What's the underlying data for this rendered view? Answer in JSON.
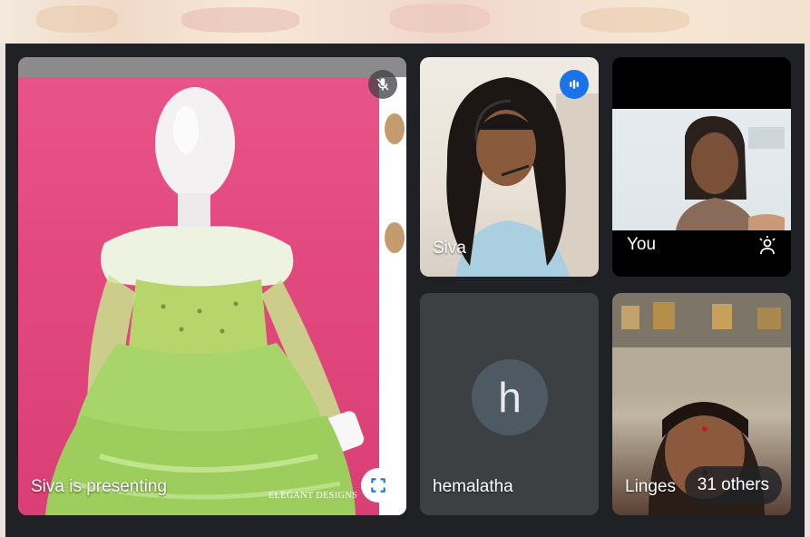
{
  "presentation": {
    "label": "Siva is presenting",
    "brand_line1": "ELEGANT DESIGNS",
    "mic_icon": "mic-off-icon",
    "fullscreen_icon": "fullscreen-icon"
  },
  "participants": [
    {
      "name": "Siva",
      "status_icon": "speaking-indicator-icon"
    },
    {
      "name": "You",
      "status_icon": "raise-hand-icon"
    },
    {
      "name": "hemalatha",
      "avatar_letter": "h"
    },
    {
      "name": "Linges",
      "overflow_label": "31 others"
    }
  ],
  "colors": {
    "meeting_bg": "#202124",
    "tile_bg": "#3c4043",
    "speaking_blue": "#1a73e8",
    "slide_pink": "#e2497e"
  }
}
